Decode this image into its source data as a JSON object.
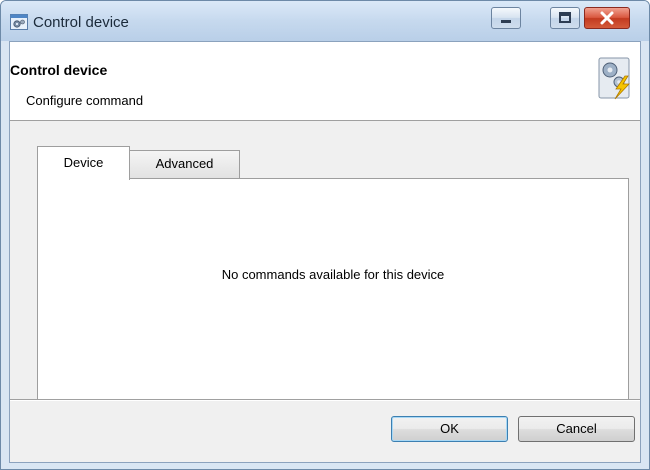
{
  "window": {
    "title": "Control device",
    "icon": "window-app-icon",
    "controls": [
      "minimize-icon",
      "maximize-icon",
      "close-icon"
    ]
  },
  "header": {
    "title": "Control device",
    "subtitle": "Configure command",
    "icon": "gear-lightning-icon"
  },
  "tabs": [
    {
      "label": "Device",
      "selected": true
    },
    {
      "label": "Advanced",
      "selected": false
    }
  ],
  "panel": {
    "message": "No commands available for this device"
  },
  "buttons": {
    "ok_label": "OK",
    "cancel_label": "Cancel"
  },
  "colors": {
    "titlebar": "#c6d9ee",
    "close_button": "#c23a20",
    "dialog_bg": "#f0f0f0",
    "default_button_border": "#3c7fb1"
  }
}
